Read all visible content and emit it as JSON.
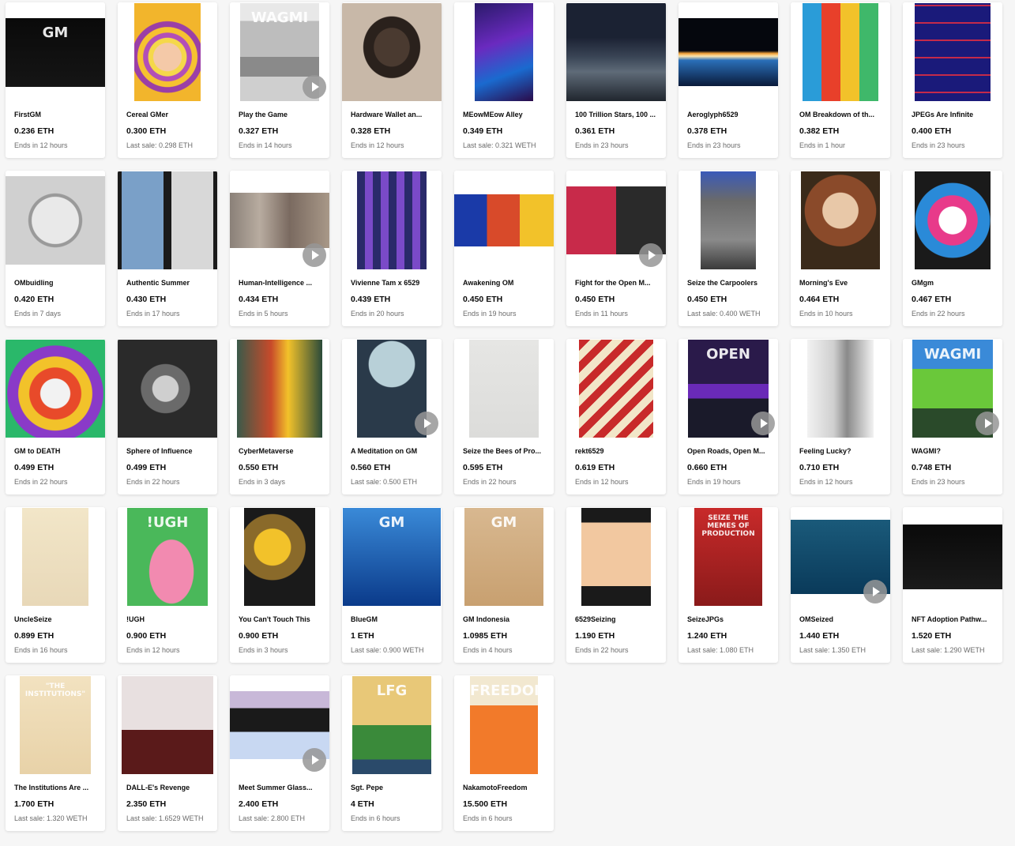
{
  "items": [
    {
      "name": "FirstGM",
      "price": "0.236 ETH",
      "status": "Ends in 12 hours",
      "art": {
        "w": 126,
        "h": 87,
        "bg": "linear-gradient(#0a0a0a,#151515)"
      },
      "art_text": "GM",
      "play": false
    },
    {
      "name": "Cereal GMer",
      "price": "0.300 ETH",
      "status": "Last sale: 0.298 ETH",
      "art": {
        "w": 84,
        "h": 124,
        "bg": "radial-gradient(circle at 50% 55%, #f4c9a8 0 22%, #f5d84a 23% 30%, #b24fb8 31% 38%, #f6c230 39% 47%, #9b3fa6 48% 56%, #f2b52c 57%)"
      },
      "play": false
    },
    {
      "name": "Play the Game",
      "price": "0.327 ETH",
      "status": "Ends in 14 hours",
      "art": {
        "w": 100,
        "h": 124,
        "bg": "linear-gradient(#e8e8e8 0 18%, #bdbdbd 18% 55%, #8a8a8a 55% 75%, #cfcfcf 75%)"
      },
      "art_text": "WAGMI",
      "play": true
    },
    {
      "name": "Hardware Wallet an...",
      "price": "0.328 ETH",
      "status": "Ends in 12 hours",
      "art": {
        "w": 126,
        "h": 124,
        "bg": "radial-gradient(ellipse at 50% 45%, #4a3a30 0 25%, #2a211c 26% 40%, #c8b8a8 41%)"
      },
      "play": false
    },
    {
      "name": "MEowMEow Alley",
      "price": "0.349 ETH",
      "status": "Last sale: 0.321 WETH",
      "art": {
        "w": 74,
        "h": 124,
        "bg": "linear-gradient(160deg,#2a1a6a,#6a2abf 40%,#1a6acf 70%,#2a0a4a)"
      },
      "play": false
    },
    {
      "name": "100 Trillion Stars, 100 ...",
      "price": "0.361 ETH",
      "status": "Ends in 23 hours",
      "art": {
        "w": 126,
        "h": 124,
        "bg": "linear-gradient(#1b2233 0 35%, #3a4556 55%, #5f6b78 70%, #20262e)"
      },
      "play": false
    },
    {
      "name": "Aeroglyph6529",
      "price": "0.378 ETH",
      "status": "Ends in 23 hours",
      "art": {
        "w": 126,
        "h": 86,
        "bg": "linear-gradient(#05070d 0 48%, #f2a23a 52%, #fbe6b0 56%, #2a6fb8 62%, #0a1a3a)"
      },
      "play": false
    },
    {
      "name": "OM Breakdown of th...",
      "price": "0.382 ETH",
      "status": "Ends in 1 hour",
      "art": {
        "w": 96,
        "h": 124,
        "bg": "linear-gradient(90deg,#2a9cd8 0 25%,#e8402a 25% 50%,#f2c22a 50% 75%,#3fb86a 75%)"
      },
      "play": false
    },
    {
      "name": "JPEGs Are Infinite",
      "price": "0.400 ETH",
      "status": "Ends in 23 hours",
      "art": {
        "w": 96,
        "h": 124,
        "bg": "repeating-linear-gradient(0deg,#1a1a7a 0 10px,#c42a4a 10px 12px,#1a1a7a 12px 22px)"
      },
      "play": false
    },
    {
      "name": "OMbuidling",
      "price": "0.420 ETH",
      "status": "Ends in 7 days",
      "art": {
        "w": 126,
        "h": 112,
        "bg": "radial-gradient(circle at 50% 50%, #e9e9e9 0 35%, #9a9a9a 36% 40%, #d0d0d0 41%)"
      },
      "play": false
    },
    {
      "name": "Authentic Summer",
      "price": "0.430 ETH",
      "status": "Ends in 17 hours",
      "art": {
        "w": 126,
        "h": 124,
        "bg": "linear-gradient(90deg,#1a1a1a 0 4%,#7aa0c8 4% 46%,#1a1a1a 46% 54%,#d8d8d8 54% 96%,#1a1a1a 96%)"
      },
      "play": false
    },
    {
      "name": "Human-Intelligence ...",
      "price": "0.434 ETH",
      "status": "Ends in 5 hours",
      "art": {
        "w": 126,
        "h": 70,
        "bg": "linear-gradient(90deg,#8a8078,#b8aca0 30%,#7a6a60 60%,#a89888)"
      },
      "play": true
    },
    {
      "name": "Vivienne Tam x 6529",
      "price": "0.439 ETH",
      "status": "Ends in 20 hours",
      "art": {
        "w": 88,
        "h": 124,
        "bg": "repeating-linear-gradient(90deg,#2a2a6a 0 10px,#7a4ac8 10px 20px)"
      },
      "play": false
    },
    {
      "name": "Awakening OM",
      "price": "0.450 ETH",
      "status": "Ends in 19 hours",
      "art": {
        "w": 126,
        "h": 66,
        "bg": "linear-gradient(90deg,#1a3aa8 0 33%,#d84a2a 33% 66%,#f2c22a 66%)"
      },
      "play": false
    },
    {
      "name": "Fight for the Open M...",
      "price": "0.450 ETH",
      "status": "Ends in 11 hours",
      "art": {
        "w": 126,
        "h": 86,
        "bg": "linear-gradient(90deg,#c82a4a 0 50%,#2a2a2a 50%)"
      },
      "play": true
    },
    {
      "name": "Seize the Carpoolers",
      "price": "0.450 ETH",
      "status": "Last sale: 0.400 WETH",
      "art": {
        "w": 70,
        "h": 124,
        "bg": "linear-gradient(#3a5ab8,#6a6a6a 30%,#8a8a8a 70%,#3a3a3a)"
      },
      "play": false
    },
    {
      "name": "Morning's Eve",
      "price": "0.464 ETH",
      "status": "Ends in 10 hours",
      "art": {
        "w": 100,
        "h": 124,
        "bg": "radial-gradient(circle at 50% 40%, #e8c8a8 0 25%, #8a4a2a 26% 50%, #3a2a1a 51%)"
      },
      "play": false
    },
    {
      "name": "GMgm",
      "price": "0.467 ETH",
      "status": "Ends in 22 hours",
      "art": {
        "w": 96,
        "h": 124,
        "bg": "radial-gradient(circle at 50% 50%, #ffffff 0 22%, #e83a8a 23% 40%, #2a8ad8 41% 60%, #1a1a1a 61%)"
      },
      "play": false
    },
    {
      "name": "GM to DEATH",
      "price": "0.499 ETH",
      "status": "Ends in 22 hours",
      "art": {
        "w": 126,
        "h": 124,
        "bg": "radial-gradient(circle at 50% 55%, #f2f2f2 0 20%, #e84a2a 21% 35%, #f2c22a 36% 50%, #8a3ac8 51% 65%, #2ab86a 66%)"
      },
      "play": false
    },
    {
      "name": "Sphere of Influence",
      "price": "0.499 ETH",
      "status": "Ends in 22 hours",
      "art": {
        "w": 126,
        "h": 124,
        "bg": "radial-gradient(circle at 48% 50%, #cfcfcf 0 18%, #6a6a6a 19% 34%, #2a2a2a 35%)"
      },
      "play": false
    },
    {
      "name": "CyberMetaverse",
      "price": "0.550 ETH",
      "status": "Ends in 3 days",
      "art": {
        "w": 108,
        "h": 124,
        "bg": "linear-gradient(90deg,#3a5a4a,#c84a2a 40%,#f2c22a 60%,#2a4a3a)"
      },
      "play": false
    },
    {
      "name": "A Meditation on GM",
      "price": "0.560 ETH",
      "status": "Last sale: 0.500 ETH",
      "art": {
        "w": 88,
        "h": 124,
        "bg": "radial-gradient(circle at 50% 25%, #b8d0d8 0 28%, #2a3a4a 29%)"
      },
      "play": true
    },
    {
      "name": "Seize the Bees of Pro...",
      "price": "0.595 ETH",
      "status": "Ends in 22 hours",
      "art": {
        "w": 88,
        "h": 124,
        "bg": "linear-gradient(#e6e6e4,#dcdcda)"
      },
      "play": false
    },
    {
      "name": "rekt6529",
      "price": "0.619 ETH",
      "status": "Ends in 12 hours",
      "art": {
        "w": 94,
        "h": 124,
        "bg": "repeating-linear-gradient(135deg,#c82a2a 0 10px,#f2e6c8 10px 20px)"
      },
      "play": false
    },
    {
      "name": "Open Roads, Open M...",
      "price": "0.660 ETH",
      "status": "Ends in 19 hours",
      "art": {
        "w": 102,
        "h": 124,
        "bg": "linear-gradient(#2a1a4a 0 45%,#6a2ab8 45% 60%,#1a1a2a 60%)"
      },
      "art_text": "OPEN",
      "play": true
    },
    {
      "name": "Feeling Lucky?",
      "price": "0.710 ETH",
      "status": "Ends in 12 hours",
      "art": {
        "w": 84,
        "h": 124,
        "bg": "linear-gradient(90deg,#f2f2f2,#cfcfcf 40%,#8a8a8a 60%,#f2f2f2)"
      },
      "play": false
    },
    {
      "name": "WAGMI?",
      "price": "0.748 ETH",
      "status": "Ends in 23 hours",
      "art": {
        "w": 102,
        "h": 124,
        "bg": "linear-gradient(#3a8ad8 0 30%,#6ac83a 30% 70%,#2a4a2a 70%)"
      },
      "art_text": "WAGMI",
      "play": true
    },
    {
      "name": "UncleSeize",
      "price": "0.899 ETH",
      "status": "Ends in 16 hours",
      "art": {
        "w": 84,
        "h": 124,
        "bg": "linear-gradient(#f2e6c8,#e8d8b8)"
      },
      "play": false
    },
    {
      "name": "!UGH",
      "price": "0.900 ETH",
      "status": "Ends in 12 hours",
      "art": {
        "w": 102,
        "h": 124,
        "bg": "radial-gradient(ellipse at 55% 65%, #f28ab0 0 35%, #4ab85a 36%)"
      },
      "art_text": "!UGH",
      "play": false
    },
    {
      "name": "You Can't Touch This",
      "price": "0.900 ETH",
      "status": "Ends in 3 hours",
      "art": {
        "w": 90,
        "h": 124,
        "bg": "radial-gradient(circle at 40% 40%, #f2c22a 0 25%, #8a6a2a 26% 45%, #1a1a1a 46%)"
      },
      "play": false
    },
    {
      "name": "BlueGM",
      "price": "1 ETH",
      "status": "Last sale: 0.900 WETH",
      "art": {
        "w": 124,
        "h": 124,
        "bg": "linear-gradient(#3a8ad8,#0a3a8a)"
      },
      "art_text": "GM",
      "play": false
    },
    {
      "name": "GM Indonesia",
      "price": "1.0985 ETH",
      "status": "Ends in 4 hours",
      "art": {
        "w": 100,
        "h": 124,
        "bg": "linear-gradient(#d8b890,#c8a070)"
      },
      "art_text": "GM",
      "play": false
    },
    {
      "name": "6529Seizing",
      "price": "1.190 ETH",
      "status": "Ends in 22 hours",
      "art": {
        "w": 88,
        "h": 124,
        "bg": "linear-gradient(#1a1a1a 0 15%,#f2c8a0 15% 80%,#1a1a1a 80%)"
      },
      "play": false
    },
    {
      "name": "SeizeJPGs",
      "price": "1.240 ETH",
      "status": "Last sale: 1.080 ETH",
      "art": {
        "w": 86,
        "h": 124,
        "bg": "linear-gradient(#c82a2a,#8a1a1a)"
      },
      "art_text": "SEIZE THE MEMES OF PRODUCTION",
      "play": false
    },
    {
      "name": "OMSeized",
      "price": "1.440 ETH",
      "status": "Last sale: 1.350 ETH",
      "art": {
        "w": 126,
        "h": 94,
        "bg": "linear-gradient(#1a5a7a,#0a3a5a)"
      },
      "play": true
    },
    {
      "name": "NFT Adoption Pathw...",
      "price": "1.520 ETH",
      "status": "Last sale: 1.290 WETH",
      "art": {
        "w": 126,
        "h": 82,
        "bg": "linear-gradient(#0a0a0a,#1a1a1a)"
      },
      "play": false
    },
    {
      "name": "The Institutions Are ...",
      "price": "1.700 ETH",
      "status": "Last sale: 1.320 WETH",
      "art": {
        "w": 90,
        "h": 124,
        "bg": "linear-gradient(#f2e2c0,#e8d2a8)"
      },
      "art_text": "\"THE INSTITUTIONS\"",
      "play": false
    },
    {
      "name": "DALL-E's Revenge",
      "price": "2.350 ETH",
      "status": "Last sale: 1.6529 WETH",
      "art": {
        "w": 116,
        "h": 124,
        "bg": "linear-gradient(#e8e0e0 0 55%,#5a1a1a 55%)"
      },
      "play": false
    },
    {
      "name": "Meet Summer Glass...",
      "price": "2.400 ETH",
      "status": "Last sale: 2.800 ETH",
      "art": {
        "w": 126,
        "h": 86,
        "bg": "linear-gradient(#c8b8d8 0 25%,#1a1a1a 25% 60%,#c8d8f2 60%)"
      },
      "play": true
    },
    {
      "name": "Sgt. Pepe",
      "price": "4 ETH",
      "status": "Ends in 6 hours",
      "art": {
        "w": 100,
        "h": 124,
        "bg": "linear-gradient(#e8c878 0 50%,#3a8a3a 50% 85%,#2a4a6a 85%)"
      },
      "art_text": "LFG",
      "play": false
    },
    {
      "name": "NakamotoFreedom",
      "price": "15.500 ETH",
      "status": "Ends in 6 hours",
      "art": {
        "w": 86,
        "h": 124,
        "bg": "linear-gradient(#f2e8d0 0 30%,#f27a2a 30%)"
      },
      "art_text": "FREEDOM",
      "play": false
    }
  ]
}
